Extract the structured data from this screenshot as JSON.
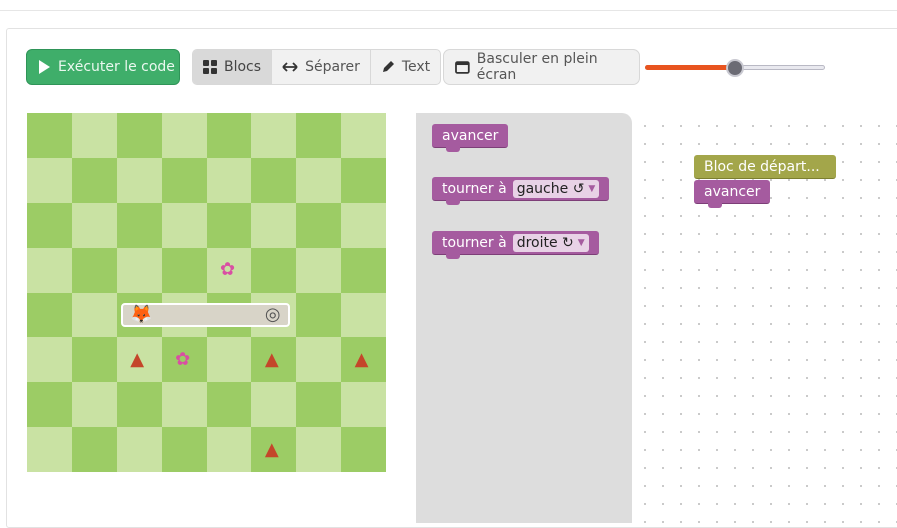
{
  "toolbar": {
    "run_label": "Exécuter le code",
    "tabs": [
      {
        "label": "Blocs",
        "icon": "grid-icon",
        "active": true
      },
      {
        "label": "Séparer",
        "icon": "split-arrows-icon",
        "active": false
      },
      {
        "label": "Text",
        "icon": "pencil-icon",
        "active": false
      }
    ],
    "fullscreen_label": "Basculer en plein écran",
    "speed_slider": {
      "value": 0.5,
      "fill_color": "#e8541f"
    }
  },
  "board": {
    "rows": 8,
    "cols": 8,
    "light_color": "#c9e2a3",
    "dark_color": "#9ccc65",
    "pieces": [
      {
        "type": "fox-player-icon",
        "glyph": "🦊",
        "row": 4,
        "col": 2
      },
      {
        "type": "goal-target-icon",
        "glyph": "◎",
        "row": 4,
        "col": 5
      },
      {
        "type": "flower-icon",
        "glyph": "✿",
        "row": 3,
        "col": 4
      },
      {
        "type": "flower-icon",
        "glyph": "✿",
        "row": 5,
        "col": 3
      },
      {
        "type": "beetle-enemy-icon",
        "glyph": "▲",
        "row": 5,
        "col": 2
      },
      {
        "type": "beetle-enemy-icon",
        "glyph": "▲",
        "row": 5,
        "col": 5
      },
      {
        "type": "beetle-enemy-icon",
        "glyph": "▲",
        "row": 5,
        "col": 7
      },
      {
        "type": "beetle-enemy-icon",
        "glyph": "▲",
        "row": 7,
        "col": 5
      }
    ],
    "path": {
      "row": 4,
      "from_col": 2,
      "to_col": 5
    }
  },
  "toolbox": {
    "blocks": [
      {
        "label": "avancer"
      },
      {
        "label": "tourner à",
        "dropdown": "gauche ↺"
      },
      {
        "label": "tourner à",
        "dropdown": "droite ↻"
      }
    ]
  },
  "workspace": {
    "start_block": "Bloc de départ...",
    "program": [
      {
        "label": "avancer"
      }
    ]
  }
}
